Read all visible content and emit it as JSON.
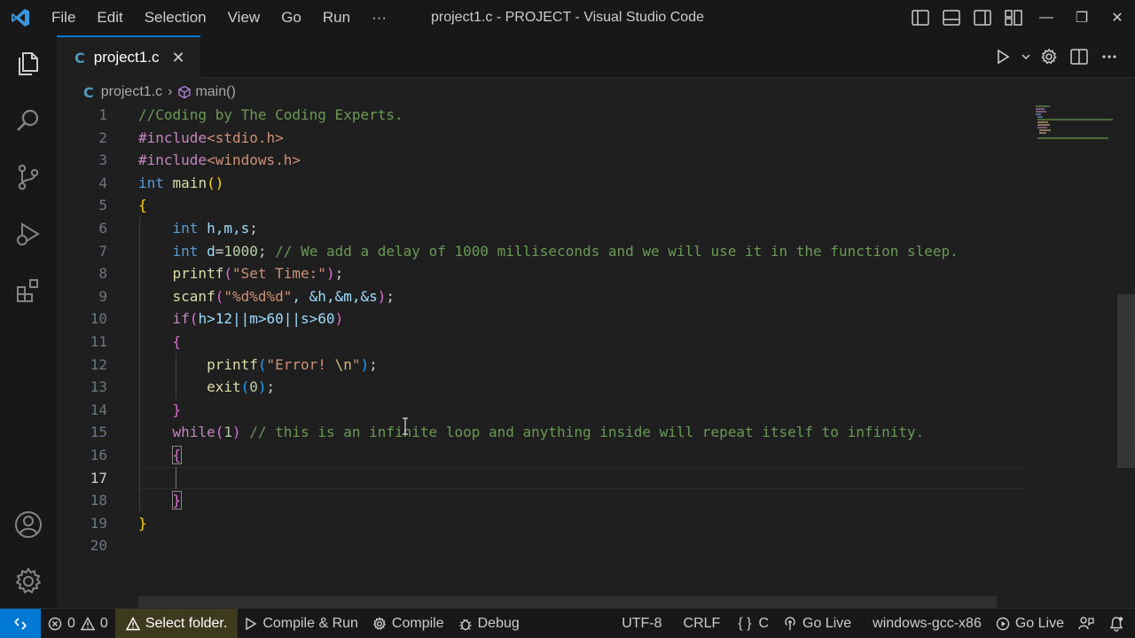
{
  "window": {
    "title": "project1.c - PROJECT - Visual Studio Code",
    "menu": [
      "File",
      "Edit",
      "Selection",
      "View",
      "Go",
      "Run",
      "···"
    ],
    "controls": {
      "minimize": "—",
      "restore": "❐",
      "close": "✕"
    }
  },
  "colors": {
    "accent": "#0078d4",
    "warning_bg": "#3e3a1e",
    "editor_bg": "#1f1f1f",
    "chrome_bg": "#181818"
  },
  "activity_bar": [
    "files-icon",
    "search-icon",
    "source-control-icon",
    "run-debug-icon",
    "extensions-icon",
    "account-icon",
    "settings-gear-icon"
  ],
  "tab": {
    "icon": "C",
    "label": "project1.c",
    "close": "✕"
  },
  "breadcrumb": {
    "icon": "C",
    "file": "project1.c",
    "separator": "›",
    "symbol": "main()"
  },
  "editor": {
    "active_line": 17,
    "line_numbers": [
      "1",
      "2",
      "3",
      "4",
      "5",
      "6",
      "7",
      "8",
      "9",
      "10",
      "11",
      "12",
      "13",
      "14",
      "15",
      "16",
      "17",
      "18",
      "19",
      "20"
    ]
  },
  "code": {
    "l1_comment": "//Coding by The Coding Experts.",
    "l2_pp": "#include",
    "l2_hdr": "<stdio.h>",
    "l3_pp": "#include",
    "l3_hdr": "<windows.h>",
    "l4_kw": "int",
    "l4_fn": "main",
    "l4_paren": "()",
    "l5_brace": "{",
    "l6_kw": "int",
    "l6_vars": "h,m,s",
    "l6_semi": ";",
    "l7_kw": "int",
    "l7_var": "d",
    "l7_eq": "=",
    "l7_num": "1000",
    "l7_semi": ";",
    "l7_comment": "// We add a delay of 1000 milliseconds and we will use it in the function sleep.",
    "l8_fn": "printf",
    "l8_open": "(",
    "l8_str": "\"Set Time:\"",
    "l8_close": ")",
    "l8_semi": ";",
    "l9_fn": "scanf",
    "l9_open": "(",
    "l9_str": "\"%d%d%d\"",
    "l9_args": ", &h,&m,&s",
    "l9_close": ")",
    "l9_semi": ";",
    "l10_kw": "if",
    "l10_open": "(",
    "l10_cond": "h>12||m>60||s>60",
    "l10_close": ")",
    "l11_brace": "{",
    "l12_fn": "printf",
    "l12_open": "(",
    "l12_str": "\"Error! ",
    "l12_esc": "\\n",
    "l12_strend": "\"",
    "l12_close": ")",
    "l12_semi": ";",
    "l13_fn": "exit",
    "l13_open": "(",
    "l13_num": "0",
    "l13_close": ")",
    "l13_semi": ";",
    "l14_brace": "}",
    "l15_kw": "while",
    "l15_open": "(",
    "l15_num": "1",
    "l15_close": ")",
    "l15_comment": "// this is an infinite loop and anything inside will repeat itself to infinity.",
    "l16_brace": "{",
    "l18_brace": "}",
    "l19_brace": "}"
  },
  "statusbar": {
    "errors": "0",
    "warnings": "0",
    "select_folder": "Select folder.",
    "compile_run": "Compile & Run",
    "compile": "Compile",
    "debug": "Debug",
    "encoding": "UTF-8",
    "eol": "CRLF",
    "language_braces": "{ }",
    "language": "C",
    "go_live_1": "Go Live",
    "compiler": "windows-gcc-x86",
    "go_live_2": "Go Live"
  }
}
